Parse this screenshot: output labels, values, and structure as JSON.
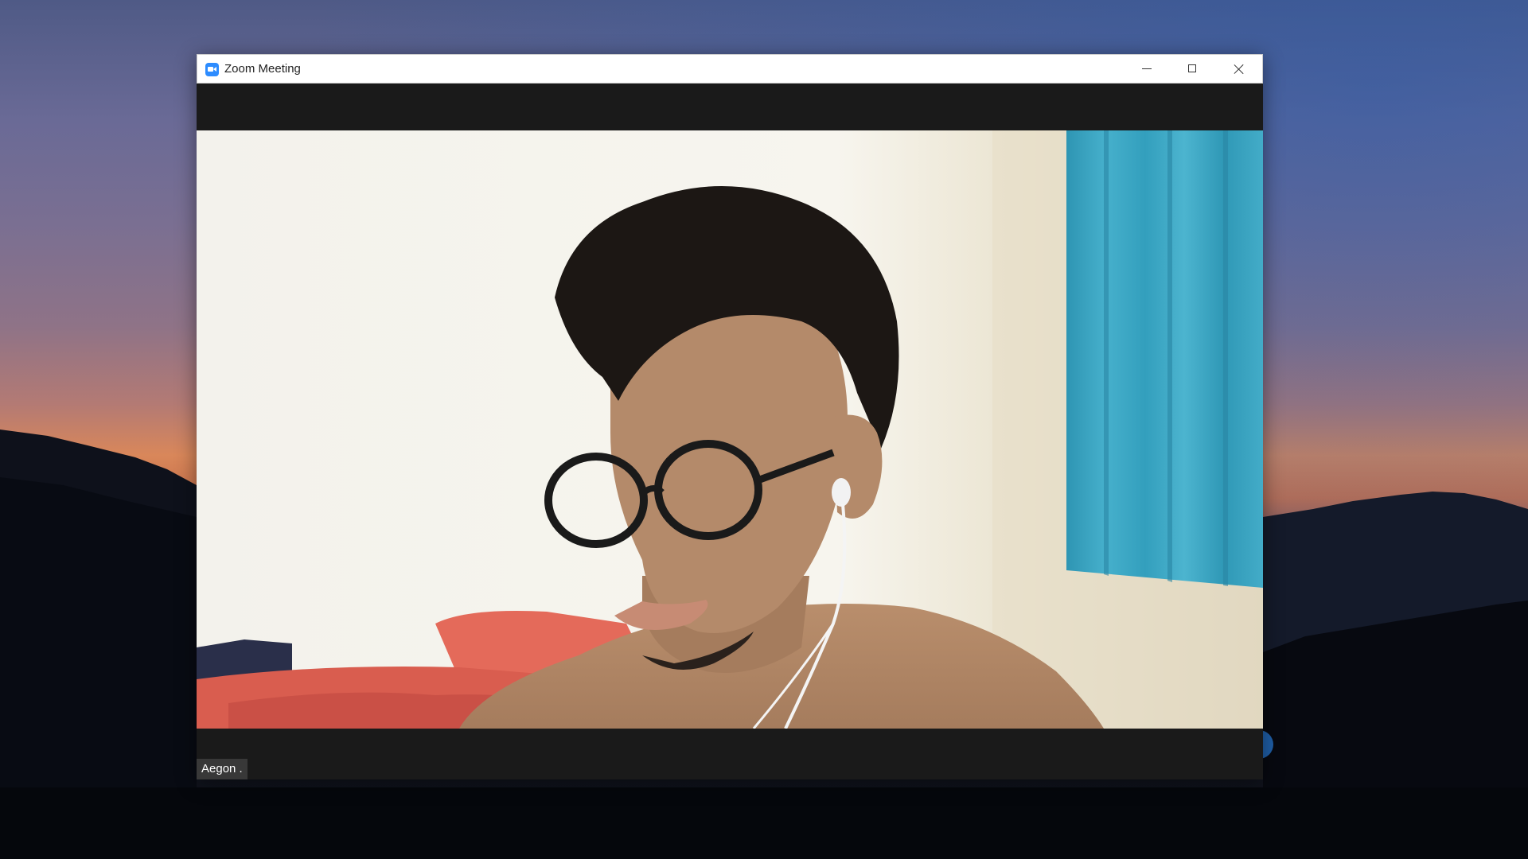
{
  "window": {
    "title": "Zoom Meeting",
    "app_icon": "zoom-camera-icon"
  },
  "title_controls": {
    "minimize_icon": "minimize-icon",
    "maximize_icon": "maximize-icon",
    "close_icon": "close-icon"
  },
  "video": {
    "participant_name": "Aegon ."
  },
  "colors": {
    "zoom_blue": "#2d8cff",
    "meeting_background": "#1a1a1a",
    "name_label_background": "#3c3c3c",
    "curtain": "#3aa6c4"
  }
}
